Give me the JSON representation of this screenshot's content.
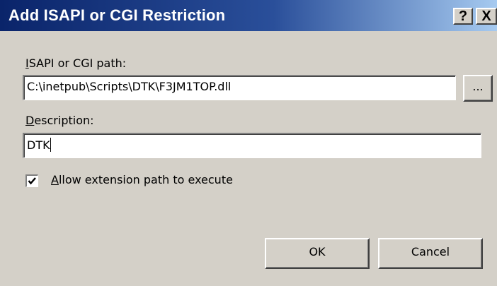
{
  "window": {
    "title": "Add ISAPI or CGI Restriction",
    "help_glyph": "?",
    "close_glyph": "X"
  },
  "path_field": {
    "label_accel": "I",
    "label_rest": "SAPI or CGI path:",
    "value": "C:\\inetpub\\Scripts\\DTK\\F3JM1TOP.dll"
  },
  "browse_button": {
    "label": "..."
  },
  "description_field": {
    "label_accel": "D",
    "label_rest": "escription:",
    "value": "DTK"
  },
  "allow_checkbox": {
    "checked": true,
    "label_accel": "A",
    "label_rest": "llow extension path to execute"
  },
  "buttons": {
    "ok": "OK",
    "cancel": "Cancel"
  }
}
